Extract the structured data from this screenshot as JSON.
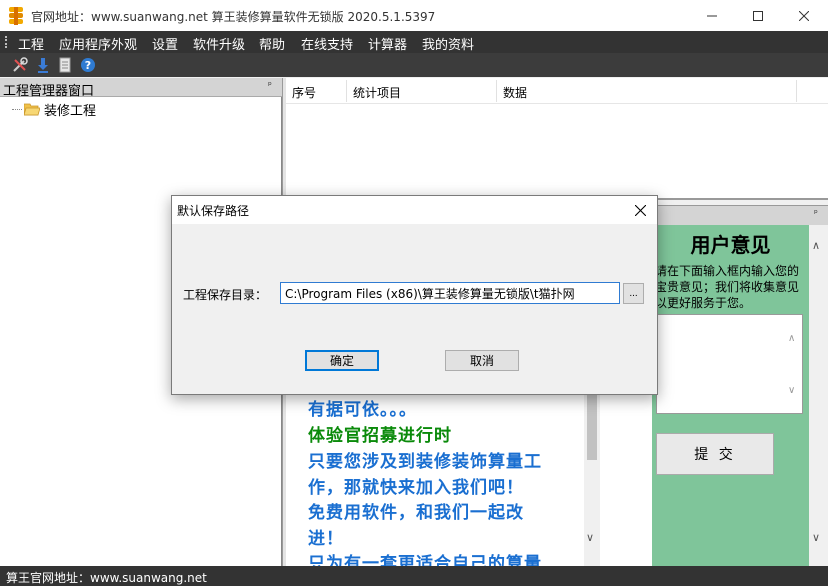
{
  "window": {
    "title": "官网地址：www.suanwang.net    算王装修算量软件无锁版 2020.5.1.5397"
  },
  "menu": {
    "items": [
      "工程",
      "应用程序外观",
      "设置",
      "软件升级",
      "帮助",
      "在线支持",
      "计算器",
      "我的资料"
    ]
  },
  "toolbar": {
    "icons": [
      "tools-icon",
      "download-icon",
      "document-icon",
      "help-icon"
    ]
  },
  "left_panel": {
    "title": "工程管理器窗口",
    "tree_root": "装修工程"
  },
  "stats_table": {
    "columns": [
      "序号",
      "统计项目",
      "数据"
    ]
  },
  "promo": {
    "lines": [
      {
        "text": "有据可依。。。",
        "color": "#1a6fd1"
      },
      {
        "text": "体验官招募进行时",
        "color": "#0a8a0a"
      },
      {
        "text": "只要您涉及到装修装饰算量工",
        "color": "#1a6fd1"
      },
      {
        "text": "作，那就快来加入我们吧！",
        "color": "#1a6fd1"
      },
      {
        "text": "免费用软件，和我们一起改",
        "color": "#1a6fd1"
      },
      {
        "text": "进！",
        "color": "#1a6fd1"
      },
      {
        "text": "只为有一套更适合自己的算量",
        "color": "#1a6fd1"
      }
    ]
  },
  "feedback": {
    "title": "用户意见",
    "description": "请在下面输入框内输入您的宝贵意见；我们将收集意见以更好服务于您。",
    "submit_label": "提 交",
    "background": "#7fc59a"
  },
  "status": {
    "text": "算王官网地址：www.suanwang.net"
  },
  "dialog": {
    "title": "默认保存路径",
    "label": "工程保存目录：",
    "path_value": "C:\\Program Files (x86)\\算王装修算量无锁版\\t猫扑网",
    "browse_label": "...",
    "ok_label": "确定",
    "cancel_label": "取消"
  }
}
